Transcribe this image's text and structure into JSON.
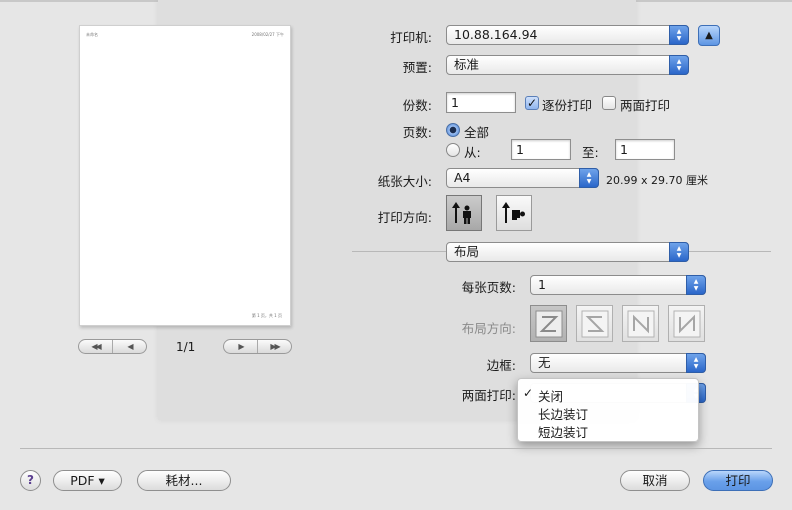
{
  "preview": {
    "header_left": "未命名",
    "header_right": "2008/02/27 下午",
    "footer": "第 1 页，共 1 页",
    "page_indicator": "1/1",
    "nav_first": "◀◀",
    "nav_prev": "◀",
    "nav_next": "▶",
    "nav_last": "▶▶"
  },
  "printer": {
    "label": "打印机:",
    "value": "10.88.164.94",
    "disclosure": "▲"
  },
  "presets": {
    "label": "预置:",
    "value": "标准"
  },
  "copies": {
    "label": "份数:",
    "value": "1",
    "collate_label": "逐份打印",
    "collate_checked": true,
    "duplex_label": "两面打印",
    "duplex_checked": false
  },
  "pages": {
    "label": "页数:",
    "all_label": "全部",
    "from_label": "从:",
    "from_value": "1",
    "to_label": "至:",
    "to_value": "1",
    "selected": "all"
  },
  "paper_size": {
    "label": "纸张大小:",
    "value": "A4",
    "dimensions": "20.99 x 29.70 厘米"
  },
  "orientation": {
    "label": "打印方向:",
    "selected": "portrait"
  },
  "section": {
    "value": "布局"
  },
  "layout": {
    "pages_per_sheet_label": "每张页数:",
    "pages_per_sheet": "1",
    "direction_label": "布局方向:",
    "border_label": "边框:",
    "border_value": "无",
    "duplex_label": "两面打印:"
  },
  "duplex_menu": {
    "items": [
      "关闭",
      "长边装订",
      "短边装订"
    ],
    "selected_mark": "✓"
  },
  "footer": {
    "help": "?",
    "pdf": "PDF ▾",
    "supplies": "耗材...",
    "cancel": "取消",
    "print": "打印"
  },
  "colors": {
    "accent": "#3d7de0",
    "window_bg": "#e6e6e6"
  }
}
